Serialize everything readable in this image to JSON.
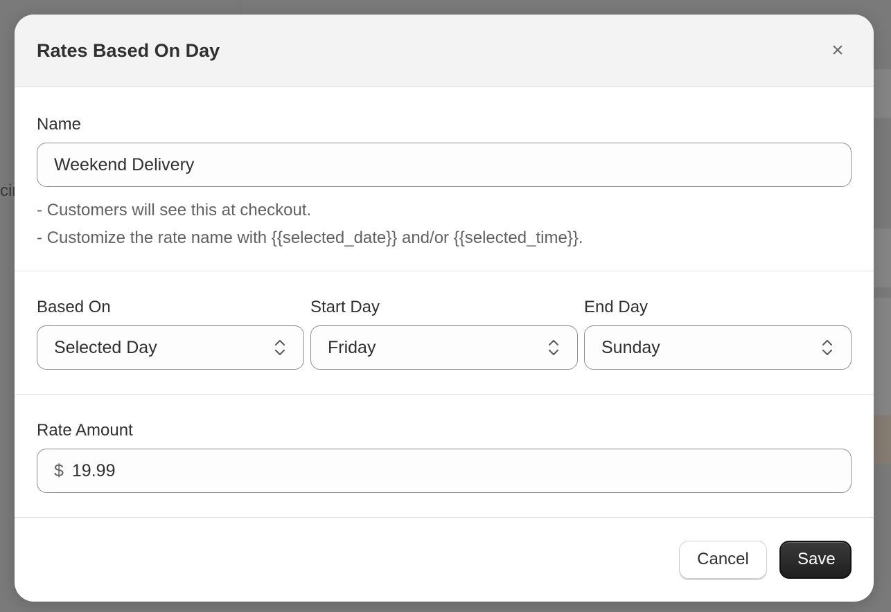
{
  "background": {
    "partial_text": "cir"
  },
  "modal": {
    "title": "Rates Based On Day",
    "close_label": "×"
  },
  "name_section": {
    "label": "Name",
    "value": "Weekend Delivery",
    "help_lines": [
      "- Customers will see this at checkout.",
      "- Customize the rate name with {{selected_date}} and/or {{selected_time}}."
    ]
  },
  "days_section": {
    "based_on": {
      "label": "Based On",
      "value": "Selected Day"
    },
    "start_day": {
      "label": "Start Day",
      "value": "Friday"
    },
    "end_day": {
      "label": "End Day",
      "value": "Sunday"
    }
  },
  "rate_section": {
    "label": "Rate Amount",
    "currency": "$",
    "value": "19.99"
  },
  "footer": {
    "cancel_label": "Cancel",
    "save_label": "Save"
  },
  "colors": {
    "overlay": "#7a7a7a",
    "header_bg": "#f3f3f3",
    "primary_button": "#2b2b2b"
  }
}
